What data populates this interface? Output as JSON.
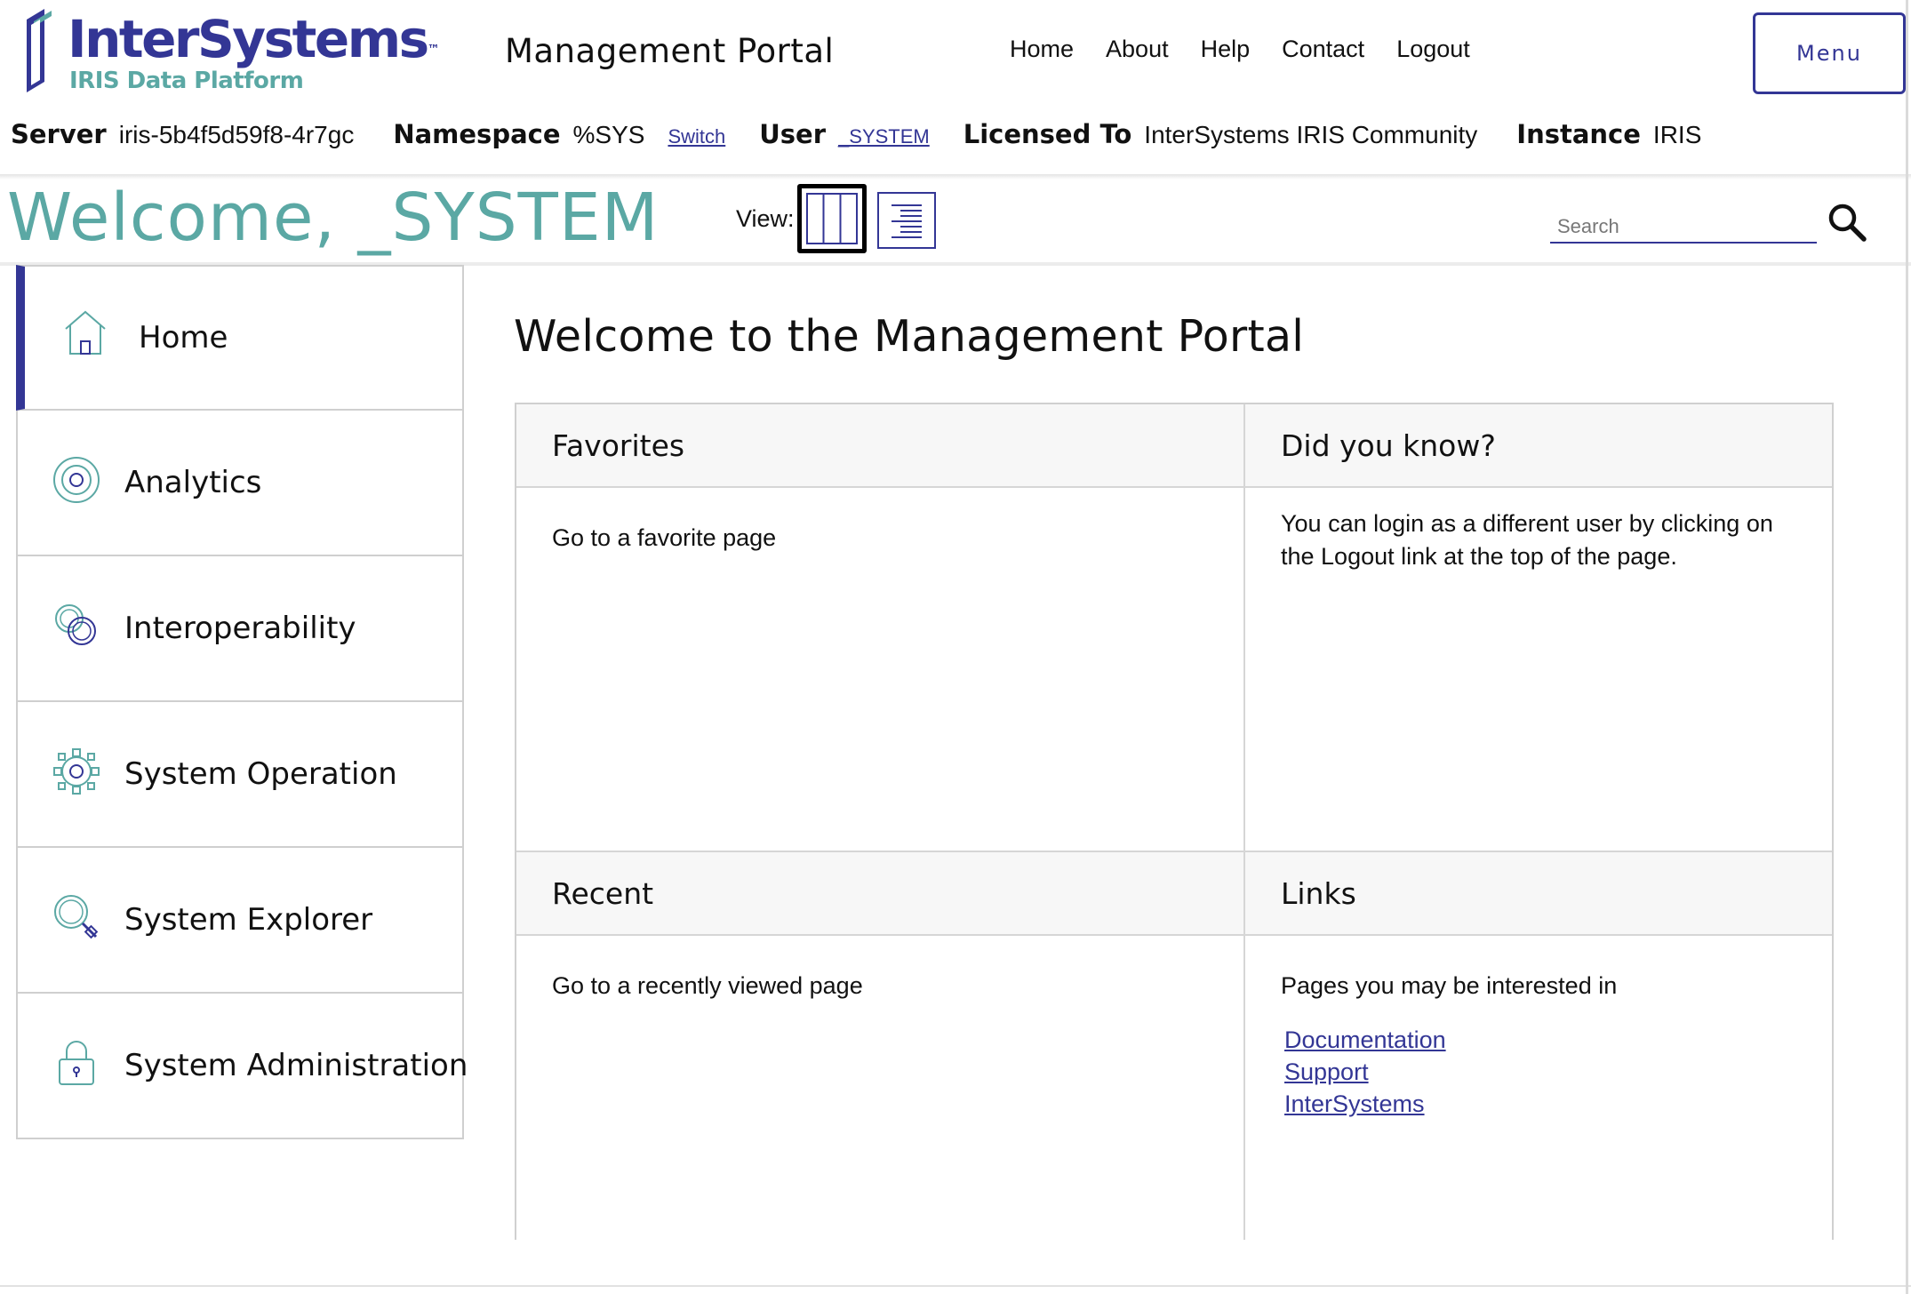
{
  "header": {
    "logo_name": "InterSystems",
    "logo_tm": "™",
    "logo_sub": "IRIS Data Platform",
    "portal_title": "Management Portal",
    "nav": [
      {
        "label": "Home"
      },
      {
        "label": "About"
      },
      {
        "label": "Help"
      },
      {
        "label": "Contact"
      },
      {
        "label": "Logout"
      }
    ],
    "menu_label": "Menu"
  },
  "infobar": {
    "server_label": "Server",
    "server_value": "iris-5b4f5d59f8-4r7gc",
    "namespace_label": "Namespace",
    "namespace_value": "%SYS",
    "switch_link": "Switch",
    "user_label": "User",
    "user_value": "_SYSTEM",
    "licensed_label": "Licensed To",
    "licensed_value": "InterSystems IRIS Community",
    "instance_label": "Instance",
    "instance_value": "IRIS"
  },
  "welcome": {
    "text": "Welcome, _SYSTEM",
    "view_label": "View:",
    "search_placeholder": "Search"
  },
  "sidebar": {
    "items": [
      {
        "label": "Home",
        "icon": "home-icon",
        "active": true
      },
      {
        "label": "Analytics",
        "icon": "target-icon"
      },
      {
        "label": "Interoperability",
        "icon": "rings-icon"
      },
      {
        "label": "System Operation",
        "icon": "gear-icon"
      },
      {
        "label": "System Explorer",
        "icon": "magnifier-icon"
      },
      {
        "label": "System Administration",
        "icon": "lock-icon"
      }
    ]
  },
  "main": {
    "title": "Welcome to the Management Portal",
    "favorites": {
      "title": "Favorites",
      "body": "Go to a favorite page"
    },
    "did_you_know": {
      "title": "Did you know?",
      "body": "You can login as a different user by clicking on the Logout link at the top of the page."
    },
    "recent": {
      "title": "Recent",
      "body": "Go to a recently viewed page"
    },
    "links": {
      "title": "Links",
      "body": "Pages you may be interested in",
      "items": [
        "Documentation",
        "Support",
        "InterSystems"
      ]
    }
  },
  "colors": {
    "brand_navy": "#333695",
    "brand_teal": "#5ba8a4",
    "panel_header_bg": "#f7f7f7",
    "border": "#d0d0d0"
  }
}
